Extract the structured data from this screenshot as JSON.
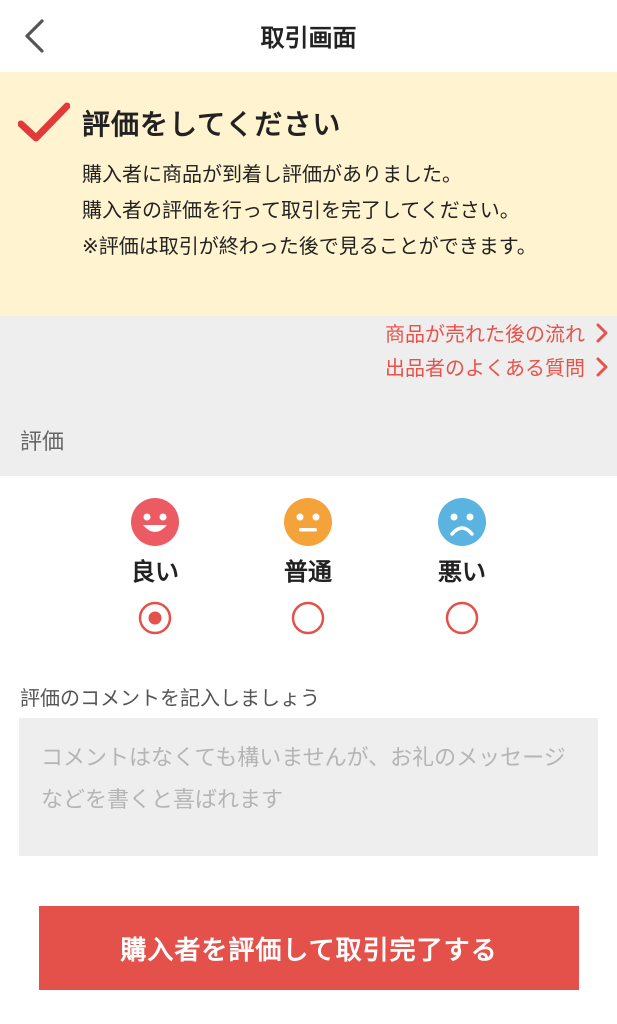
{
  "header": {
    "back_icon": "chevron-left-icon",
    "title": "取引画面"
  },
  "notice": {
    "icon": "checkmark-icon",
    "heading": "評価をしてください",
    "lines": [
      "購入者に商品が到着し評価がありました。",
      "購入者の評価を行って取引を完了してください。",
      "※評価は取引が終わった後で見ることができます。"
    ]
  },
  "links": [
    {
      "label": "商品が売れた後の流れ",
      "icon": "chevron-right-icon"
    },
    {
      "label": "出品者のよくある質問",
      "icon": "chevron-right-icon"
    }
  ],
  "rating_section": {
    "label": "評価",
    "options": [
      {
        "label": "良い",
        "icon": "smile-face-icon",
        "color": "#ec5a63",
        "selected": true
      },
      {
        "label": "普通",
        "icon": "neutral-face-icon",
        "color": "#f4a23a",
        "selected": false
      },
      {
        "label": "悪い",
        "icon": "sad-face-icon",
        "color": "#5bb4df",
        "selected": false
      }
    ]
  },
  "comment": {
    "label": "評価のコメントを記入しましょう",
    "placeholder": "コメントはなくても構いませんが、お礼のメッセージなどを書くと喜ばれます",
    "value": ""
  },
  "submit": {
    "label": "購入者を評価して取引完了する"
  },
  "colors": {
    "accent": "#e3514a",
    "notice_bg": "#fff4cf",
    "section_bg": "#eeeeee"
  }
}
